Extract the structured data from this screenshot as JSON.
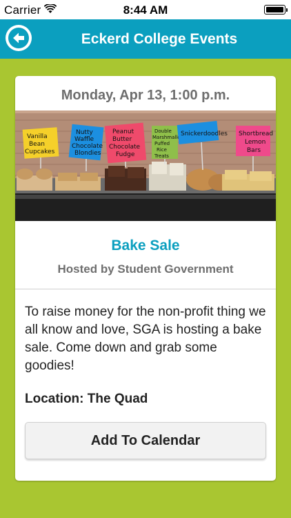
{
  "status_bar": {
    "carrier": "Carrier",
    "time": "8:44 AM"
  },
  "nav": {
    "title": "Eckerd College Events",
    "back_icon": "back-arrow-icon",
    "color": "#0b9fbf"
  },
  "event": {
    "date": "Monday, Apr 13, 1:00 p.m.",
    "title": "Bake Sale",
    "host": "Hosted by Student Government",
    "description": "To raise money for the non-profit thing we all know and love, SGA is hosting a bake sale. Come down and grab some goodies!",
    "location": "Location: The Quad",
    "photo_labels": [
      "Vanilla Bean Cupcakes",
      "Nutty Waffle Chocolate Blondies",
      "Peanut Butter Chocolate Fudge",
      "Double Marshmallow Puffed Rice Treats",
      "Snickerdoodles",
      "Shortbread Lemon Bars"
    ]
  },
  "actions": {
    "add_to_calendar": "Add To Calendar"
  },
  "colors": {
    "background": "#a9c631",
    "accent": "#0b9fbf"
  }
}
